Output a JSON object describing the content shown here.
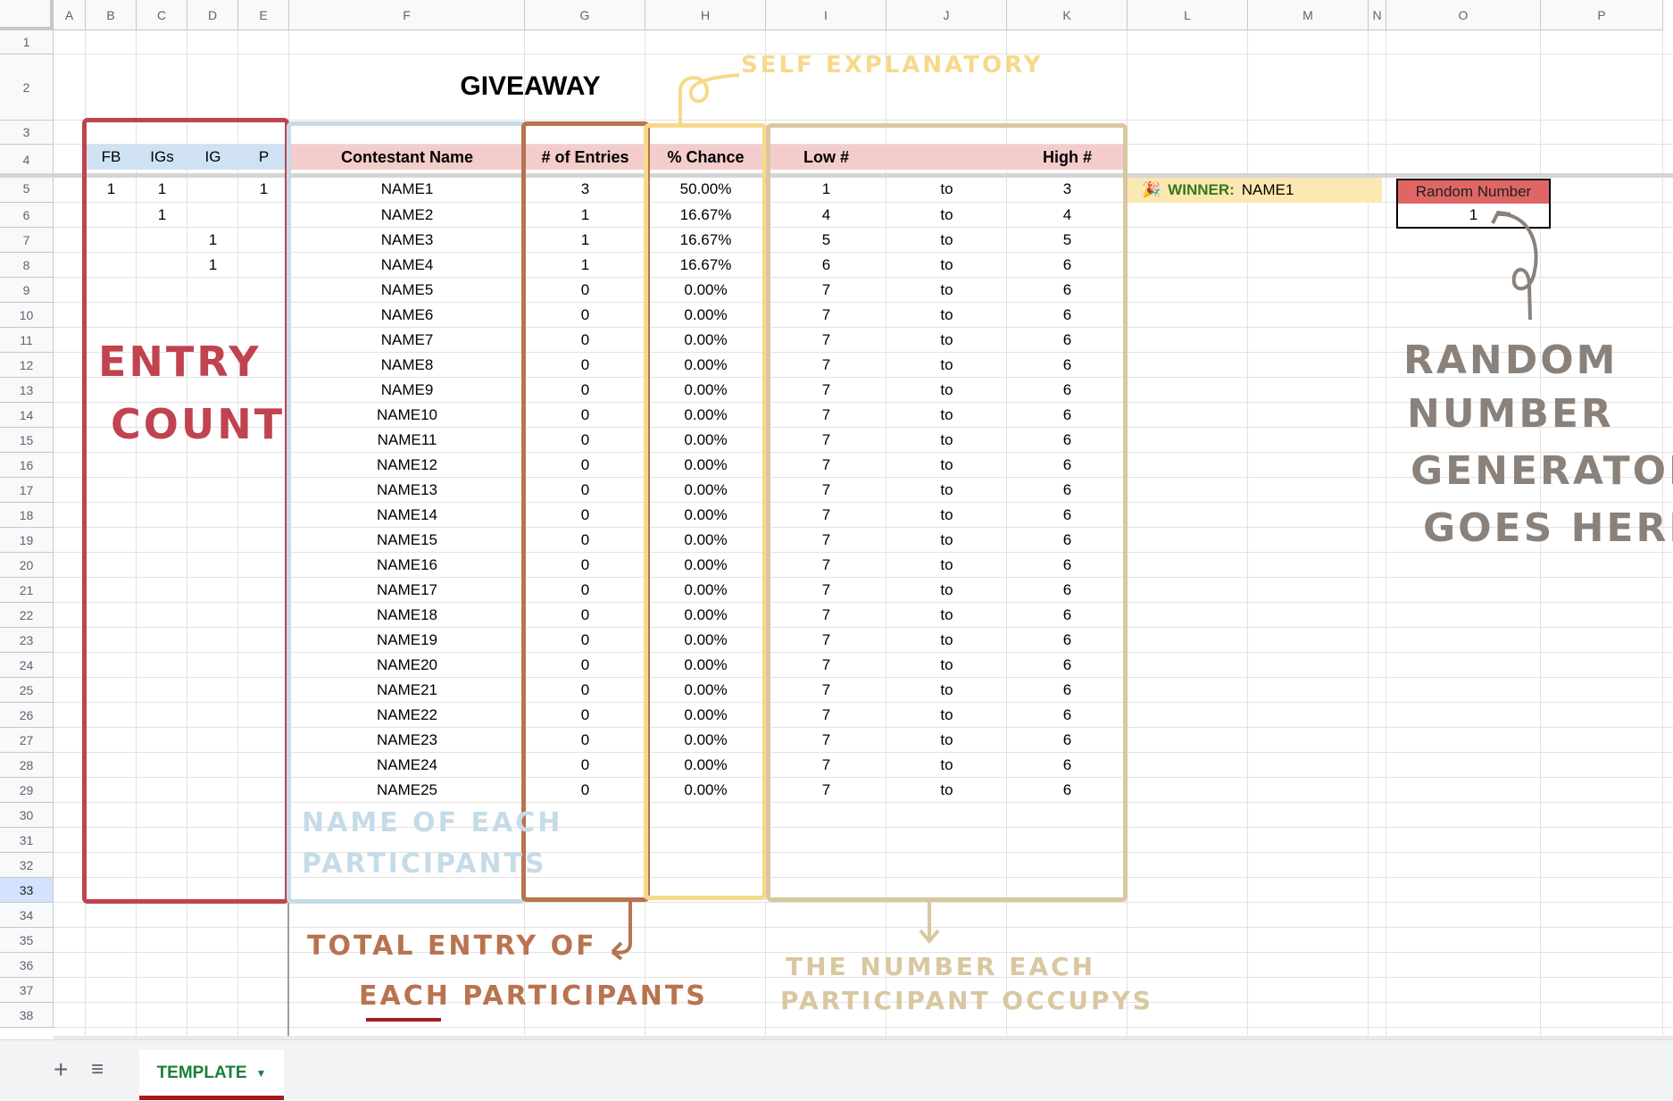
{
  "columns": [
    "A",
    "B",
    "C",
    "D",
    "E",
    "F",
    "G",
    "H",
    "I",
    "J",
    "K",
    "L",
    "M",
    "N",
    "O",
    "P"
  ],
  "row_numbers": [
    1,
    2,
    3,
    4,
    5,
    6,
    7,
    8,
    9,
    10,
    11,
    12,
    13,
    14,
    15,
    16,
    17,
    18,
    19,
    20,
    21,
    22,
    23,
    24,
    25,
    26,
    27,
    28,
    29,
    30,
    31,
    32,
    33,
    34,
    35,
    36,
    37,
    38
  ],
  "selected_row": 33,
  "title": "GIVEAWAY",
  "headers": {
    "fb": "FB",
    "igs": "IGs",
    "ig": "IG",
    "p": "P",
    "contestant": "Contestant Name",
    "entries": "# of Entries",
    "chance": "% Chance",
    "low": "Low #",
    "high": "High #"
  },
  "rows": [
    {
      "fb": "1",
      "igs": "1",
      "ig": "",
      "p": "1",
      "name": "NAME1",
      "entries": "3",
      "chance": "50.00%",
      "low": "1",
      "to": "to",
      "high": "3"
    },
    {
      "fb": "",
      "igs": "1",
      "ig": "",
      "p": "",
      "name": "NAME2",
      "entries": "1",
      "chance": "16.67%",
      "low": "4",
      "to": "to",
      "high": "4"
    },
    {
      "fb": "",
      "igs": "",
      "ig": "1",
      "p": "",
      "name": "NAME3",
      "entries": "1",
      "chance": "16.67%",
      "low": "5",
      "to": "to",
      "high": "5"
    },
    {
      "fb": "",
      "igs": "",
      "ig": "1",
      "p": "",
      "name": "NAME4",
      "entries": "1",
      "chance": "16.67%",
      "low": "6",
      "to": "to",
      "high": "6"
    },
    {
      "fb": "",
      "igs": "",
      "ig": "",
      "p": "",
      "name": "NAME5",
      "entries": "0",
      "chance": "0.00%",
      "low": "7",
      "to": "to",
      "high": "6"
    },
    {
      "fb": "",
      "igs": "",
      "ig": "",
      "p": "",
      "name": "NAME6",
      "entries": "0",
      "chance": "0.00%",
      "low": "7",
      "to": "to",
      "high": "6"
    },
    {
      "fb": "",
      "igs": "",
      "ig": "",
      "p": "",
      "name": "NAME7",
      "entries": "0",
      "chance": "0.00%",
      "low": "7",
      "to": "to",
      "high": "6"
    },
    {
      "fb": "",
      "igs": "",
      "ig": "",
      "p": "",
      "name": "NAME8",
      "entries": "0",
      "chance": "0.00%",
      "low": "7",
      "to": "to",
      "high": "6"
    },
    {
      "fb": "",
      "igs": "",
      "ig": "",
      "p": "",
      "name": "NAME9",
      "entries": "0",
      "chance": "0.00%",
      "low": "7",
      "to": "to",
      "high": "6"
    },
    {
      "fb": "",
      "igs": "",
      "ig": "",
      "p": "",
      "name": "NAME10",
      "entries": "0",
      "chance": "0.00%",
      "low": "7",
      "to": "to",
      "high": "6"
    },
    {
      "fb": "",
      "igs": "",
      "ig": "",
      "p": "",
      "name": "NAME11",
      "entries": "0",
      "chance": "0.00%",
      "low": "7",
      "to": "to",
      "high": "6"
    },
    {
      "fb": "",
      "igs": "",
      "ig": "",
      "p": "",
      "name": "NAME12",
      "entries": "0",
      "chance": "0.00%",
      "low": "7",
      "to": "to",
      "high": "6"
    },
    {
      "fb": "",
      "igs": "",
      "ig": "",
      "p": "",
      "name": "NAME13",
      "entries": "0",
      "chance": "0.00%",
      "low": "7",
      "to": "to",
      "high": "6"
    },
    {
      "fb": "",
      "igs": "",
      "ig": "",
      "p": "",
      "name": "NAME14",
      "entries": "0",
      "chance": "0.00%",
      "low": "7",
      "to": "to",
      "high": "6"
    },
    {
      "fb": "",
      "igs": "",
      "ig": "",
      "p": "",
      "name": "NAME15",
      "entries": "0",
      "chance": "0.00%",
      "low": "7",
      "to": "to",
      "high": "6"
    },
    {
      "fb": "",
      "igs": "",
      "ig": "",
      "p": "",
      "name": "NAME16",
      "entries": "0",
      "chance": "0.00%",
      "low": "7",
      "to": "to",
      "high": "6"
    },
    {
      "fb": "",
      "igs": "",
      "ig": "",
      "p": "",
      "name": "NAME17",
      "entries": "0",
      "chance": "0.00%",
      "low": "7",
      "to": "to",
      "high": "6"
    },
    {
      "fb": "",
      "igs": "",
      "ig": "",
      "p": "",
      "name": "NAME18",
      "entries": "0",
      "chance": "0.00%",
      "low": "7",
      "to": "to",
      "high": "6"
    },
    {
      "fb": "",
      "igs": "",
      "ig": "",
      "p": "",
      "name": "NAME19",
      "entries": "0",
      "chance": "0.00%",
      "low": "7",
      "to": "to",
      "high": "6"
    },
    {
      "fb": "",
      "igs": "",
      "ig": "",
      "p": "",
      "name": "NAME20",
      "entries": "0",
      "chance": "0.00%",
      "low": "7",
      "to": "to",
      "high": "6"
    },
    {
      "fb": "",
      "igs": "",
      "ig": "",
      "p": "",
      "name": "NAME21",
      "entries": "0",
      "chance": "0.00%",
      "low": "7",
      "to": "to",
      "high": "6"
    },
    {
      "fb": "",
      "igs": "",
      "ig": "",
      "p": "",
      "name": "NAME22",
      "entries": "0",
      "chance": "0.00%",
      "low": "7",
      "to": "to",
      "high": "6"
    },
    {
      "fb": "",
      "igs": "",
      "ig": "",
      "p": "",
      "name": "NAME23",
      "entries": "0",
      "chance": "0.00%",
      "low": "7",
      "to": "to",
      "high": "6"
    },
    {
      "fb": "",
      "igs": "",
      "ig": "",
      "p": "",
      "name": "NAME24",
      "entries": "0",
      "chance": "0.00%",
      "low": "7",
      "to": "to",
      "high": "6"
    },
    {
      "fb": "",
      "igs": "",
      "ig": "",
      "p": "",
      "name": "NAME25",
      "entries": "0",
      "chance": "0.00%",
      "low": "7",
      "to": "to",
      "high": "6"
    }
  ],
  "winner": {
    "icon": "party-popper-icon",
    "label": "WINNER:",
    "value": "NAME1"
  },
  "random": {
    "header": "Random Number",
    "value": "1"
  },
  "annotations": {
    "self_explanatory": "SELF EXPLANATORY",
    "entry_count_1": "ENTRY",
    "entry_count_2": "COUNT",
    "name_each_1": "NAME OF EACH",
    "name_each_2": "PARTICIPANTS",
    "total_entry_1": "TOTAL ENTRY OF",
    "total_entry_2": "EACH PARTICIPANTS",
    "number_occupy_1": "THE NUMBER EACH",
    "number_occupy_2": "PARTICIPANT OCCUPYS",
    "rng_1": "RANDOM",
    "rng_2": "NUMBER",
    "rng_3": "GENERATOR",
    "rng_4": "GOES HERE"
  },
  "colors": {
    "red": "#c0434f",
    "blue": "#c6dbe8",
    "brown": "#b8734f",
    "yellow": "#f7d98a",
    "tan": "#d8c7a0",
    "gray": "#8a817a",
    "header_blue": "#cfe2f3",
    "header_pink": "#f4cccc",
    "winner_bg": "#fce8b2",
    "random_header": "#e06666"
  },
  "sheet_tab": {
    "label": "TEMPLATE",
    "add_icon": "plus-icon",
    "list_icon": "sheet-list-icon"
  }
}
